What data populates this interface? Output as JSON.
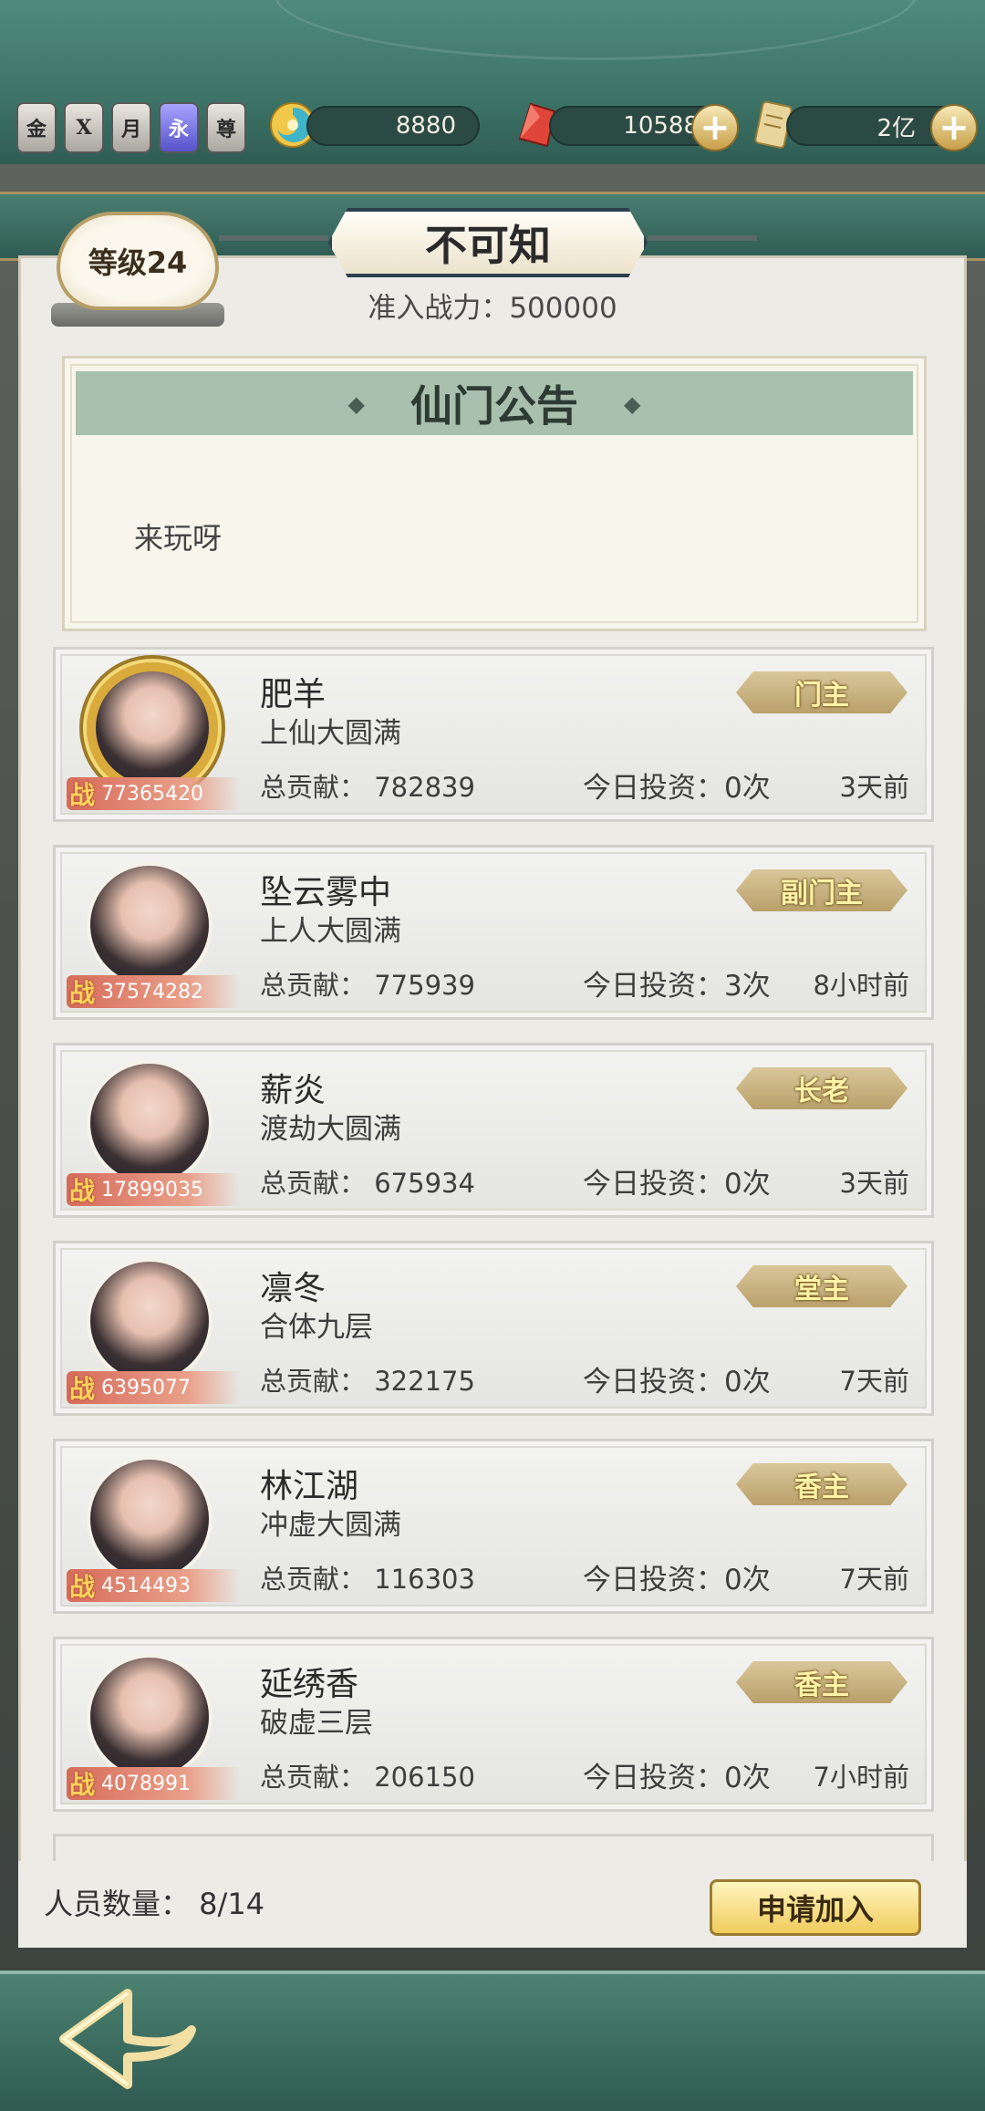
{
  "topbar": {
    "badges": [
      "金",
      "X",
      "月",
      "永",
      "尊"
    ],
    "resources": [
      {
        "icon": "swirl-orb-icon",
        "value": "8880"
      },
      {
        "icon": "red-crystal-icon",
        "value": "10588"
      },
      {
        "icon": "scroll-icon",
        "value": "2亿"
      }
    ],
    "plus_label": "+"
  },
  "sect": {
    "level_label": "等级24",
    "name": "不可知",
    "requirement": "准入战力：500000"
  },
  "notice": {
    "title": "仙门公告",
    "body": "来玩呀"
  },
  "members": [
    {
      "name": "肥羊",
      "realm": "上仙大圆满",
      "power": "77365420",
      "contribution": "总贡献：  782839",
      "invest": "今日投资：0次",
      "last_seen": "3天前",
      "role": "门主"
    },
    {
      "name": "坠云雾中",
      "realm": "上人大圆满",
      "power": "37574282",
      "contribution": "总贡献：  775939",
      "invest": "今日投资：3次",
      "last_seen": "8小时前",
      "role": "副门主"
    },
    {
      "name": "薪炎",
      "realm": "渡劫大圆满",
      "power": "17899035",
      "contribution": "总贡献：  675934",
      "invest": "今日投资：0次",
      "last_seen": "3天前",
      "role": "长老"
    },
    {
      "name": "凛冬",
      "realm": "合体九层",
      "power": "6395077",
      "contribution": "总贡献：  322175",
      "invest": "今日投资：0次",
      "last_seen": "7天前",
      "role": "堂主"
    },
    {
      "name": "林江湖",
      "realm": "冲虚大圆满",
      "power": "4514493",
      "contribution": "总贡献：  116303",
      "invest": "今日投资：0次",
      "last_seen": "7天前",
      "role": "香主"
    },
    {
      "name": "延绣香",
      "realm": "破虚三层",
      "power": "4078991",
      "contribution": "总贡献：  206150",
      "invest": "今日投资：0次",
      "last_seen": "7小时前",
      "role": "香主"
    }
  ],
  "power_glyph": "战",
  "footer": {
    "member_count": "人员数量：  8/14",
    "apply_label": "申请加入"
  }
}
